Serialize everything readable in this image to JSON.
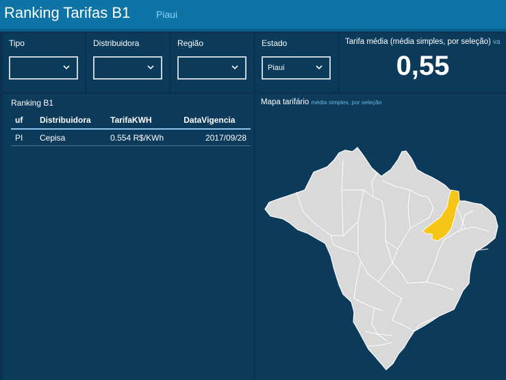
{
  "header": {
    "title": "Ranking Tarifas B1",
    "subtitle": "Piaui"
  },
  "filters": [
    {
      "label": "Tipo",
      "value": ""
    },
    {
      "label": "Distribuidora",
      "value": ""
    },
    {
      "label": "Região",
      "value": ""
    },
    {
      "label": "Estado",
      "value": "Piaui"
    }
  ],
  "kpi": {
    "label": "Tarifa média (média simples, por seleção)",
    "trail": "va",
    "value": "0,55"
  },
  "ranking": {
    "title": "Ranking B1",
    "columns": [
      "uf",
      "Distribuidora",
      "TarifaKWH",
      "DataVigencia"
    ],
    "rows": [
      {
        "uf": "PI",
        "distribuidora": "Cepisa",
        "tarifa": "0.554 R$/KWh",
        "data": "2017/09/28"
      }
    ]
  },
  "map": {
    "title": "Mapa tarifário",
    "subtitle": "média simples, por seleção",
    "highlight_color": "#f5c518",
    "base_color": "#d9d9d9"
  },
  "colors": {
    "background": "#0b3350",
    "titlebar": "#0e74a6",
    "accent": "#8fd3ff"
  }
}
